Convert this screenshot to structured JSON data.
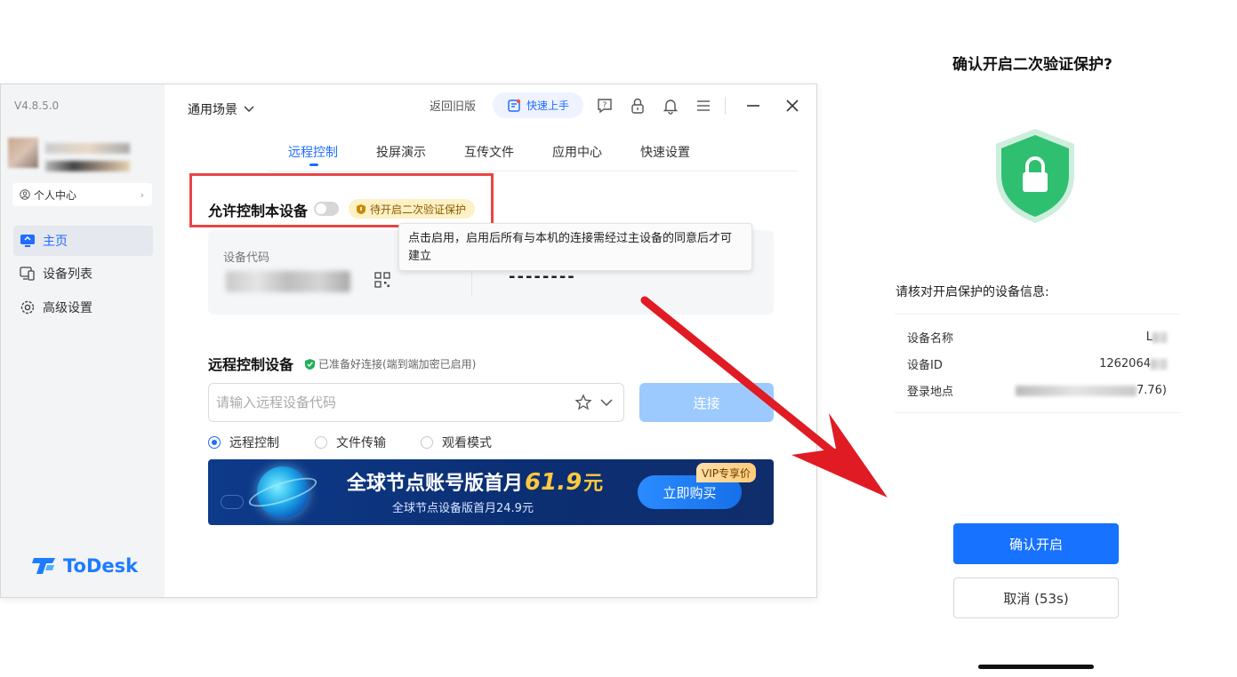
{
  "app": {
    "version": "V4.8.5.0",
    "personal_center": "个人中心",
    "nav": [
      {
        "label": "主页",
        "icon": "home-monitor-icon",
        "active": true
      },
      {
        "label": "设备列表",
        "icon": "device-list-icon",
        "active": false
      },
      {
        "label": "高级设置",
        "icon": "gear-icon",
        "active": false
      }
    ],
    "logo_text": "ToDesk",
    "scene": "通用场景",
    "back_old": "返回旧版",
    "quick_start": "快速上手",
    "tabs": [
      "远程控制",
      "投屏演示",
      "互传文件",
      "应用中心",
      "快速设置"
    ],
    "active_tab": 0,
    "allow_control_label": "允许控制本设备",
    "allow_control_enabled": false,
    "second_verify_badge": "待开启二次验证保护",
    "device_code_label": "设备代码",
    "temp_password": "--------",
    "tooltip": "点击启用，启用后所有与本机的连接需经过主设备的同意后才可建立",
    "remote_title": "远程控制设备",
    "ready_text": "已准备好连接(端到端加密已启用)",
    "remote_input_placeholder": "请输入远程设备代码",
    "connect": "连接",
    "modes": [
      {
        "label": "远程控制",
        "checked": true
      },
      {
        "label": "文件传输",
        "checked": false
      },
      {
        "label": "观看模式",
        "checked": false
      }
    ],
    "banner": {
      "main_prefix": "全球节点账号版首月",
      "price": "61.9",
      "unit": "元",
      "sub": "全球节点设备版首月24.9元",
      "buy": "立即购买",
      "vip_tag": "VIP专享价"
    }
  },
  "confirm": {
    "title": "确认开启二次验证保护?",
    "info_title": "请核对开启保护的设备信息:",
    "rows": [
      {
        "label": "设备名称",
        "value": "L"
      },
      {
        "label": "设备ID",
        "value": "1262064"
      },
      {
        "label": "登录地点",
        "value": "7.76)"
      }
    ],
    "confirm_btn": "确认开启",
    "cancel_btn": "取消 (53s)"
  },
  "colors": {
    "brand_blue": "#1f6cff",
    "highlight_red": "#e64545",
    "shield_green": "#2fbf71"
  }
}
